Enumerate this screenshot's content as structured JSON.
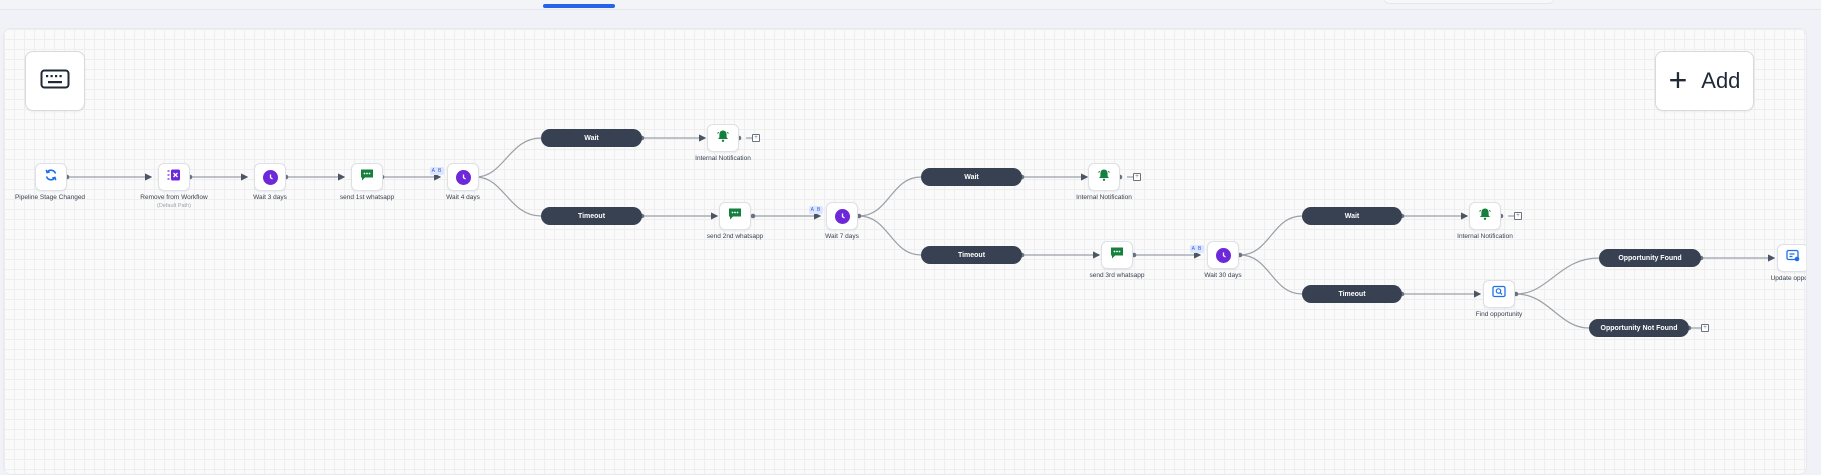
{
  "header": {
    "active_tab": ""
  },
  "toolbar": {
    "keyboard_icon": "keyboard-icon",
    "add_label": "Add",
    "add_icon": "plus-icon"
  },
  "colors": {
    "trigger": "#1f6feb",
    "wait": "#6d28d9",
    "whatsapp": "#15803d",
    "notification": "#15803d",
    "pill": "#374151",
    "accent": "#2563eb"
  },
  "workflow": {
    "nodes": [
      {
        "id": "trigger",
        "label": "Pipeline Stage Changed",
        "icon": "sync-icon"
      },
      {
        "id": "remove",
        "label": "Remove from Workflow",
        "sublabel": "(Default Path)",
        "icon": "remove-workflow-icon"
      },
      {
        "id": "wait3",
        "label": "Wait 3 days",
        "icon": "clock-icon"
      },
      {
        "id": "wa1",
        "label": "send 1st whatsapp",
        "icon": "whatsapp-message-icon"
      },
      {
        "id": "wait4",
        "label": "Wait 4 days",
        "icon": "clock-icon",
        "badge": "A B"
      },
      {
        "id": "notif1",
        "label": "Internal Notification",
        "icon": "bell-icon"
      },
      {
        "id": "wa2",
        "label": "send 2nd whatsapp",
        "icon": "whatsapp-message-icon"
      },
      {
        "id": "wait7",
        "label": "Wait 7 days",
        "icon": "clock-icon",
        "badge": "A B"
      },
      {
        "id": "notif2",
        "label": "Internal Notification",
        "icon": "bell-icon"
      },
      {
        "id": "wa3",
        "label": "send 3rd whatsapp",
        "icon": "whatsapp-message-icon"
      },
      {
        "id": "wait30",
        "label": "Wait 30 days",
        "icon": "clock-icon",
        "badge": "A B"
      },
      {
        "id": "notif3",
        "label": "Internal Notification",
        "icon": "bell-icon"
      },
      {
        "id": "find",
        "label": "Find opportunity",
        "icon": "search-opportunity-icon"
      },
      {
        "id": "update",
        "label": "Update opportu",
        "icon": "update-opportunity-icon"
      }
    ],
    "branches": [
      {
        "id": "b1",
        "label": "Wait"
      },
      {
        "id": "b2",
        "label": "Timeout"
      },
      {
        "id": "b3",
        "label": "Wait"
      },
      {
        "id": "b4",
        "label": "Timeout"
      },
      {
        "id": "b5",
        "label": "Wait"
      },
      {
        "id": "b6",
        "label": "Timeout"
      },
      {
        "id": "b7",
        "label": "Opportunity Found"
      },
      {
        "id": "b8",
        "label": "Opportunity Not Found"
      }
    ],
    "end_marker": "+"
  }
}
